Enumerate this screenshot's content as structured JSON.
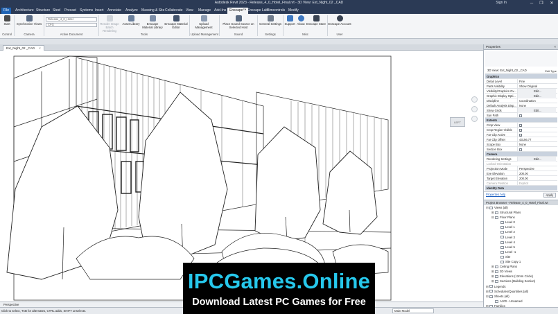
{
  "window": {
    "title": "Autodesk Revit 2023 - Release_4_0_Hotel_Final.rvt - 3D View: Ext_Night_02 _CAD",
    "signin": "Sign In",
    "minimize": "─",
    "restore": "❐",
    "close": "✕"
  },
  "ribbon_tabs": [
    "File",
    "Architecture",
    "Structure",
    "Steel",
    "Precast",
    "Systems",
    "Insert",
    "Annotate",
    "Analyze",
    "Massing & Site",
    "Collaborate",
    "View",
    "Manage",
    "Add-Ins",
    "Enscape™",
    "Enscape Lab",
    "Bimcontrols",
    "Modify"
  ],
  "active_tab": "Enscape™",
  "ribbon": {
    "start": "Start",
    "synchronize_views": "Synchronize Views",
    "active_document_select": "Release_4_0_Hotel",
    "cfg_select": "CFG",
    "render_image": "Render Image",
    "batch_rendering": "Batch Rendering",
    "asset_library": "Asset Library",
    "material_library": "Enscape Material Library",
    "material_editor": "Enscape Material Editor",
    "upload_management": "Upload Management",
    "place_sound_source": "Place Sound Source on Selected Host",
    "general_settings": "General Settings",
    "support": "Support",
    "about": "About",
    "store": "Enscape Store",
    "account": "Enscape Account",
    "panels": [
      "Control",
      "Camera",
      "Active Document",
      "Tools",
      "Upload Management",
      "Sound",
      "Settings",
      "Misc",
      "User"
    ]
  },
  "view_tab": {
    "label": "Ext_Night_02 _CAD",
    "close": "×"
  },
  "viewcube_label": "LEFT",
  "view_control": {
    "scale": "Perspective"
  },
  "status": {
    "message": "Click to select, TAB for alternates, CTRL adds, SHIFT unselects.",
    "model": "Main Model"
  },
  "properties": {
    "title": "Properties",
    "close": "×",
    "type_selector": "3D View: Ext_Night_02 _CAD",
    "edit_type": "Edit Type",
    "rows": [
      {
        "k": "Graphics",
        "section": true
      },
      {
        "k": "Detail Level",
        "v": "Fine"
      },
      {
        "k": "Parts Visibility",
        "v": "Show Original"
      },
      {
        "k": "Visibility/Graphics Ov...",
        "v": "Edit...",
        "btn": true
      },
      {
        "k": "Graphic Display Opti...",
        "v": "Edit...",
        "btn": true
      },
      {
        "k": "Discipline",
        "v": "Coordination"
      },
      {
        "k": "Default Analysis Disp...",
        "v": "None"
      },
      {
        "k": "Show Grids",
        "v": "Edit...",
        "btn": true
      },
      {
        "k": "Sun Path",
        "v": "",
        "check": false
      },
      {
        "k": "Extents",
        "section": true
      },
      {
        "k": "Crop View",
        "v": "",
        "check": true
      },
      {
        "k": "Crop Region Visible",
        "v": "",
        "check": true
      },
      {
        "k": "Far Clip Active",
        "v": "",
        "check": true
      },
      {
        "k": "Far Clip Offset",
        "v": "43156.77"
      },
      {
        "k": "Scope Box",
        "v": "None"
      },
      {
        "k": "Section Box",
        "v": "",
        "check": false
      },
      {
        "k": "Camera",
        "section": true
      },
      {
        "k": "Rendering Settings",
        "v": "Edit...",
        "btn": true
      },
      {
        "k": "Locked Orientation",
        "v": "",
        "dim": true
      },
      {
        "k": "Projection Mode",
        "v": "Perspective"
      },
      {
        "k": "Eye Elevation",
        "v": "200.00"
      },
      {
        "k": "Target Elevation",
        "v": "200.00"
      },
      {
        "k": "Camera Position",
        "v": "Explicit",
        "dim": true
      },
      {
        "k": "Identity Data",
        "section": true
      }
    ],
    "help_link": "Properties help",
    "apply": "Apply"
  },
  "browser": {
    "title": "Project Browser - Release_4_0_Hotel_Final.rvt",
    "items": [
      {
        "label": "Views (all)",
        "level": 0,
        "toggle": "⊟"
      },
      {
        "label": "Structural Plans",
        "level": 1,
        "toggle": "⊞"
      },
      {
        "label": "Floor Plans",
        "level": 1,
        "toggle": "⊟"
      },
      {
        "label": "Level 0",
        "level": 2,
        "toggle": ""
      },
      {
        "label": "Level 1",
        "level": 2,
        "toggle": ""
      },
      {
        "label": "Level 2",
        "level": 2,
        "toggle": ""
      },
      {
        "label": "Level 3",
        "level": 2,
        "toggle": ""
      },
      {
        "label": "Level 4",
        "level": 2,
        "toggle": ""
      },
      {
        "label": "Level 5",
        "level": 2,
        "toggle": ""
      },
      {
        "label": "Level -1",
        "level": 2,
        "toggle": ""
      },
      {
        "label": "Site",
        "level": 2,
        "toggle": ""
      },
      {
        "label": "Site Copy 1",
        "level": 2,
        "toggle": ""
      },
      {
        "label": "Ceiling Plans",
        "level": 1,
        "toggle": "⊞"
      },
      {
        "label": "3D Views",
        "level": 1,
        "toggle": "⊞"
      },
      {
        "label": "Elevations (12mm Circle)",
        "level": 1,
        "toggle": "⊞"
      },
      {
        "label": "Sections (Building Section)",
        "level": 1,
        "toggle": "⊞"
      },
      {
        "label": "Legends",
        "level": 0,
        "toggle": "⊞"
      },
      {
        "label": "Schedules/Quantities (all)",
        "level": 0,
        "toggle": "⊞"
      },
      {
        "label": "Sheets (all)",
        "level": 0,
        "toggle": "⊟"
      },
      {
        "label": "A100 - Unnamed",
        "level": 1,
        "toggle": ""
      },
      {
        "label": "Families",
        "level": 0,
        "toggle": "⊞"
      }
    ]
  },
  "watermark": {
    "title": "IPCGames.Online",
    "subtitle": "Download Latest PC Games for Free"
  },
  "colors": {
    "titlebar": "#2b3a55",
    "file_tab": "#1f64b5",
    "watermark_title": "#26c8ec"
  }
}
